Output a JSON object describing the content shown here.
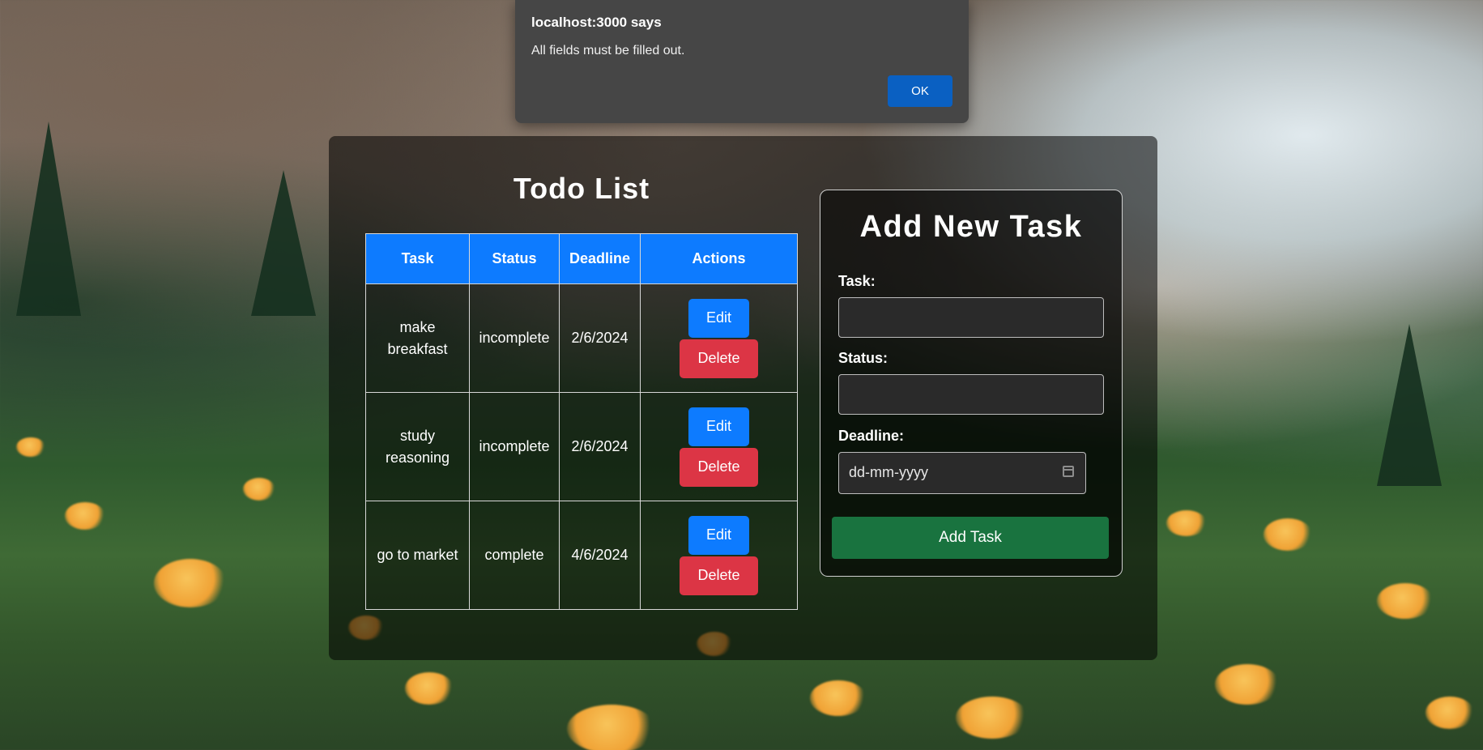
{
  "background_icon": "mountain-meadow-photo",
  "alert": {
    "title": "localhost:3000 says",
    "message": "All fields must be filled out.",
    "ok_label": "OK"
  },
  "todo": {
    "title": "Todo List",
    "columns": [
      "Task",
      "Status",
      "Deadline",
      "Actions"
    ],
    "rows": [
      {
        "task": "make breakfast",
        "status": "incomplete",
        "deadline": "2/6/2024"
      },
      {
        "task": "study reasoning",
        "status": "incomplete",
        "deadline": "2/6/2024"
      },
      {
        "task": "go to market",
        "status": "complete",
        "deadline": "4/6/2024"
      }
    ],
    "edit_label": "Edit",
    "delete_label": "Delete"
  },
  "add_task": {
    "title": "Add New Task",
    "task_label": "Task:",
    "task_value": "",
    "status_label": "Status:",
    "status_value": "",
    "deadline_label": "Deadline:",
    "deadline_placeholder": "dd-mm-yyyy",
    "submit_label": "Add Task"
  },
  "colors": {
    "primary": "#0d7bff",
    "danger": "#dc3545",
    "success": "#19733f",
    "alert_button": "#0a60c2"
  }
}
